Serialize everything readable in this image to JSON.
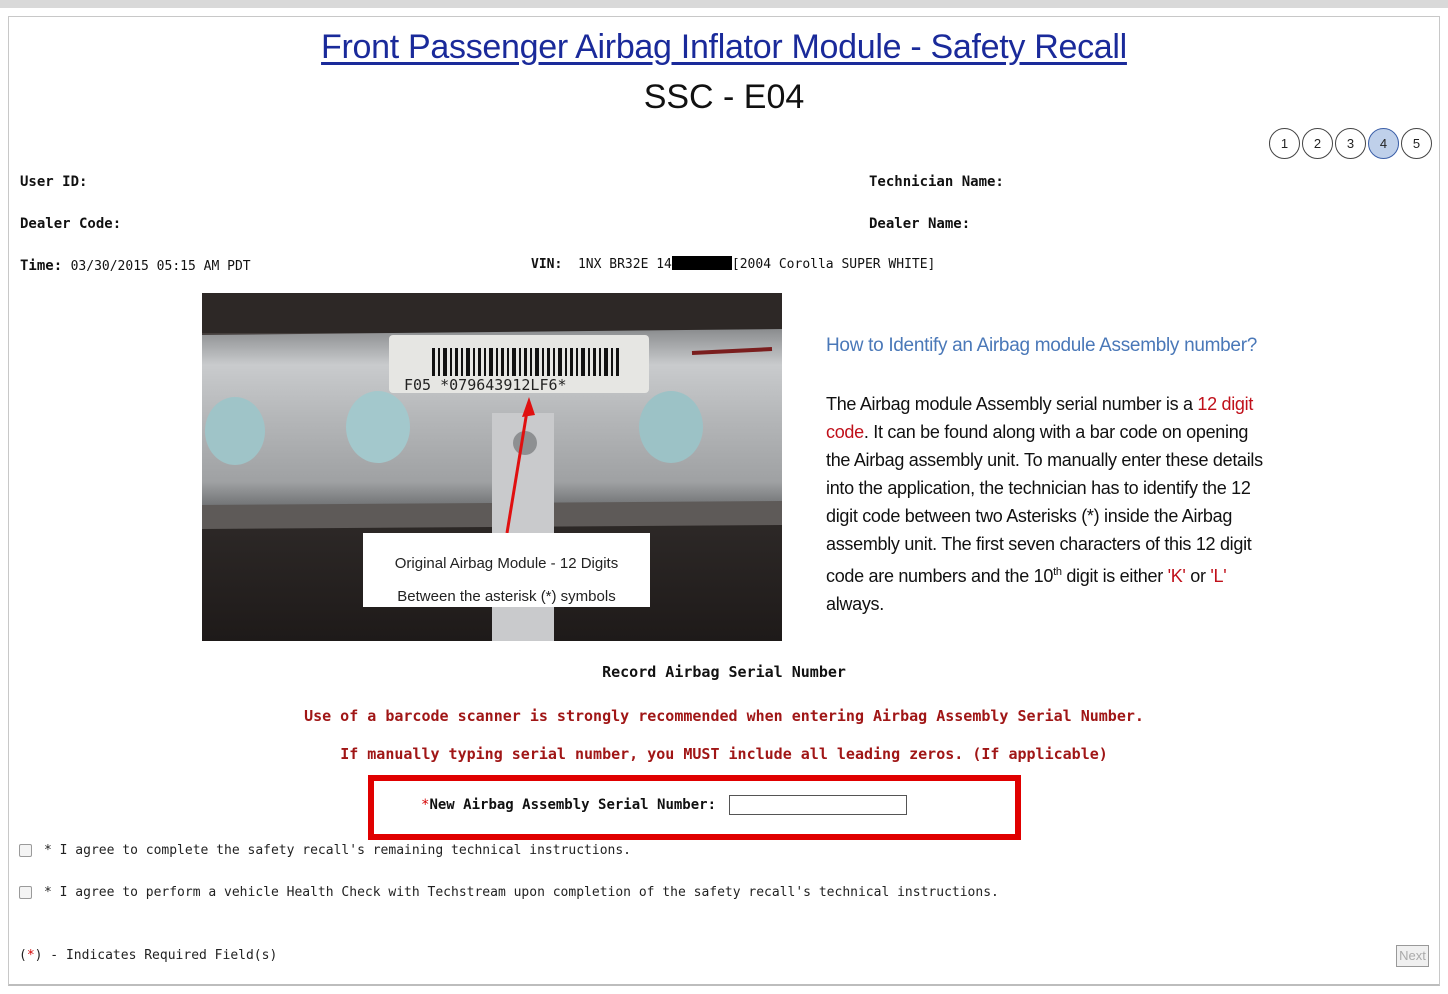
{
  "header": {
    "title": "Front Passenger Airbag Inflator Module - Safety Recall",
    "code": "SSC - E04"
  },
  "steps": {
    "items": [
      "1",
      "2",
      "3",
      "4",
      "5"
    ],
    "active": "4"
  },
  "user_info": {
    "user_id_label": "User ID:",
    "dealer_code_label": "Dealer Code:",
    "time_label": "Time:",
    "time_value": "03/30/2015 05:15 AM PDT",
    "technician_name_label": "Technician Name:",
    "dealer_name_label": "Dealer Name:",
    "vin_label": "VIN:",
    "vin_prefix": "1NX BR32E 14",
    "vin_vehicle": "[2004 Corolla SUPER WHITE]"
  },
  "photo": {
    "label_text": "F05 *079643912LF6*",
    "callout_line1": "Original Airbag Module - 12 Digits",
    "callout_line2": "Between the asterisk (*) symbols"
  },
  "info": {
    "title": "How to Identify an Airbag module Assembly number?",
    "p1": "The Airbag module Assembly serial number is a ",
    "p2": "12 digit code",
    "p3": ". It can be found along with a bar code on opening the Airbag assembly unit. To manually enter these details into the application, the technician has to identify the 12 digit code between two Asterisks (*) inside the Airbag assembly unit. The first seven characters of this 12 digit code are numbers and the 10",
    "p4": "th",
    "p5": " digit is either ",
    "p6": "'K'",
    "p7": " or ",
    "p8": "'L'",
    "p9": " always."
  },
  "record": {
    "heading": "Record Airbag Serial Number",
    "warning1": "Use of a barcode scanner is strongly recommended when entering Airbag Assembly Serial Number.",
    "warning2": "If manually typing serial number, you MUST include all leading zeros. (If applicable)",
    "required_marker": "*",
    "serial_label": "New Airbag Assembly Serial Number:",
    "serial_value": ""
  },
  "agreements": {
    "item1": "* I agree to complete the safety recall's remaining technical instructions.",
    "item2": "* I agree to perform a vehicle Health Check with Techstream upon completion of the safety recall's technical instructions."
  },
  "footer": {
    "note_open": "(",
    "note_ast": "*",
    "note_rest": ") - Indicates Required Field(s)",
    "next_label": "Next"
  },
  "colors": {
    "title_blue": "#1a2a9a",
    "info_blue": "#4a78b8",
    "warning_red": "#a01616",
    "highlight_box": "#e00000",
    "active_step": "#bfd0ea"
  }
}
